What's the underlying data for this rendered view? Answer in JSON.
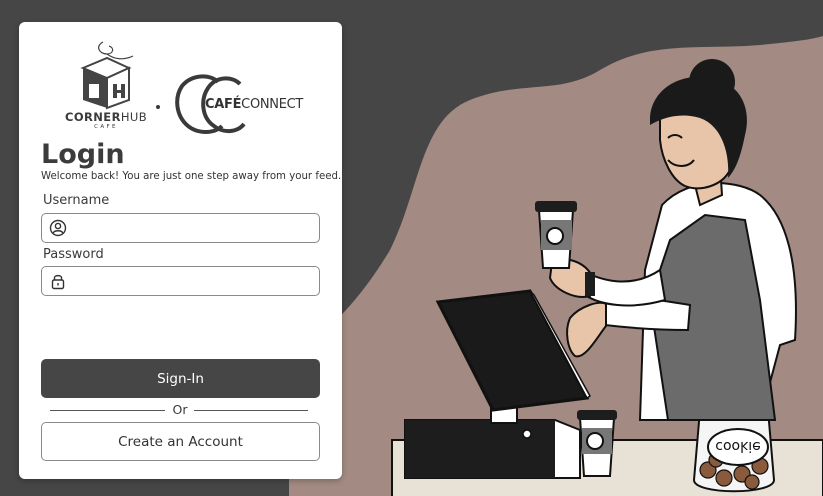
{
  "colors": {
    "background": "#464646",
    "card": "#ffffff",
    "primary_button": "#464646",
    "accent_blob": "#a38b83"
  },
  "logos": {
    "cornerhub_name_bold": "CORNER",
    "cornerhub_name_rest": "HUB",
    "cornerhub_sub": "CAFE",
    "cafeconnect_name_bold": "CAFÉ",
    "cafeconnect_name_rest": "CONNECT"
  },
  "login": {
    "title": "Login",
    "subtitle": "Welcome back! You are just one step away from your feed."
  },
  "form": {
    "username_label": "Username",
    "username_value": "",
    "username_icon": "user-circle-icon",
    "password_label": "Password",
    "password_value": "",
    "password_icon": "lock-icon",
    "signin_label": "Sign-In",
    "or_text": "Or",
    "create_label": "Create an Account"
  },
  "illustration": {
    "jar_label": "cookie"
  }
}
